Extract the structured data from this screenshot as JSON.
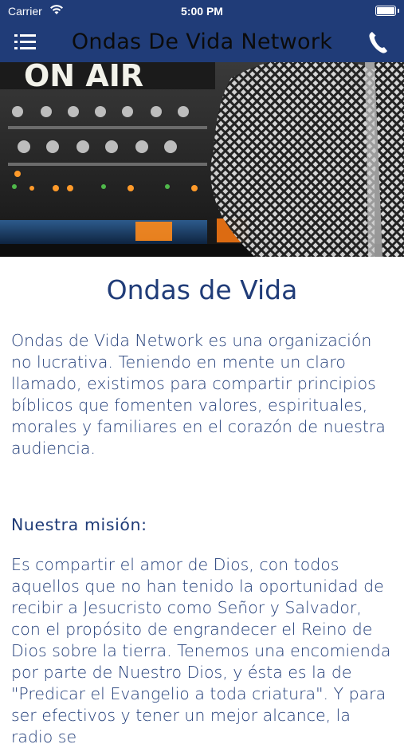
{
  "status_bar": {
    "carrier": "Carrier",
    "time": "5:00 PM"
  },
  "nav": {
    "title": "Ondas De Vida Network"
  },
  "hero": {
    "sign_text": "ON AIR"
  },
  "main": {
    "title": "Ondas de Vida",
    "intro": " Ondas de Vida Network es una organización no lucrativa. Teniendo en mente un claro llamado, existimos para compartir principios bíblicos que fomenten valores, espirituales, morales y familiares en el corazón de nuestra audiencia.",
    "mission_heading": "Nuestra misión:",
    "mission_text": "Es compartir el amor de Dios, con todos aquellos que no han tenido la oportunidad de recibir a Jesucristo como Señor y Salvador, con el propósito de engrandecer el Reino de Dios sobre la tierra. Tenemos una encomienda por parte de Nuestro Dios, y ésta es la de \"Predicar el Evangelio a toda criatura\". Y para ser efectivos y tener un mejor alcance, la radio se"
  },
  "colors": {
    "nav_bg": "#203c78",
    "text": "#203c78"
  },
  "icons": {
    "menu": "hamburger-icon",
    "phone": "phone-icon",
    "wifi": "wifi-icon",
    "battery": "battery-icon"
  }
}
